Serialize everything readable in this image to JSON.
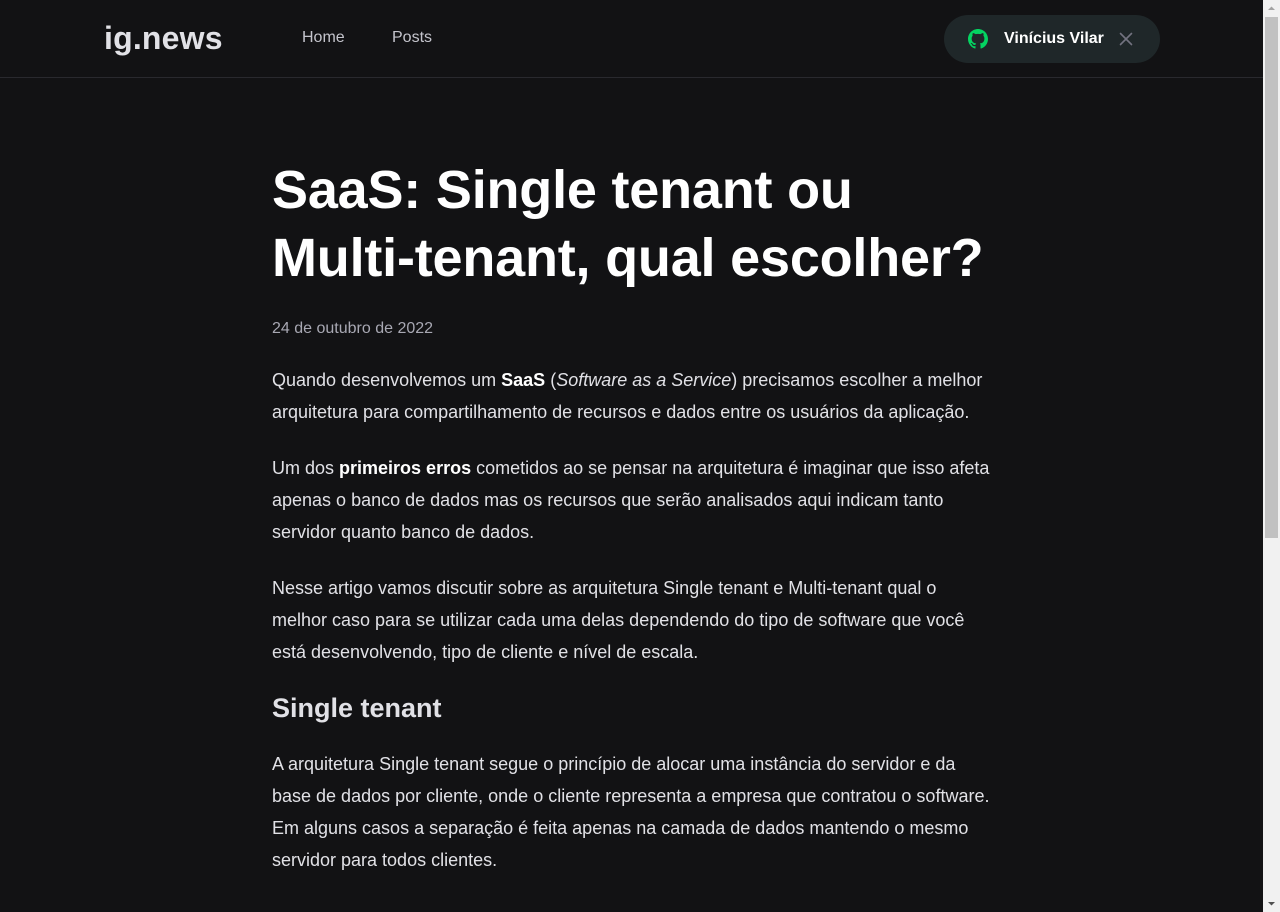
{
  "header": {
    "logo_prefix": "ig",
    "logo_suffix": ".news",
    "nav": [
      "Home",
      "Posts"
    ],
    "user_name": "Vinícius Vilar",
    "github_icon": "github-icon",
    "close_icon": "close-icon",
    "accent_color": "#04d361"
  },
  "article": {
    "title_line1": "SaaS: Single tenant ou",
    "title_line2": "Multi-tenant, qual escolher?",
    "date": "24 de outubro de 2022",
    "p1": {
      "a": "Quando desenvolvemos um ",
      "b": "SaaS",
      "c": " (",
      "d": "Software as a Service",
      "e": ") precisamos escolher a melhor arquitetura para compartilhamento de recursos e dados entre os usuários da aplicação."
    },
    "p2": {
      "a": "Um dos ",
      "b": "primeiros erros",
      "c": " cometidos ao se pensar na arquitetura é imaginar que isso afeta apenas o banco de dados mas os recursos que serão analisados aqui indicam tanto servidor quanto banco de dados."
    },
    "p3": "Nesse artigo vamos discutir sobre as arquitetura Single tenant e Multi-tenant qual o melhor caso para se utilizar cada uma delas dependendo do tipo de software que você está desenvolvendo, tipo de cliente e nível de escala.",
    "h2": "Single tenant",
    "p4": "A arquitetura Single tenant segue o princípio de alocar uma instância do servidor e da base de dados por cliente, onde o cliente representa a empresa que contratou o software. Em alguns casos a separação é feita apenas na camada de dados mantendo o mesmo servidor para todos clientes."
  }
}
